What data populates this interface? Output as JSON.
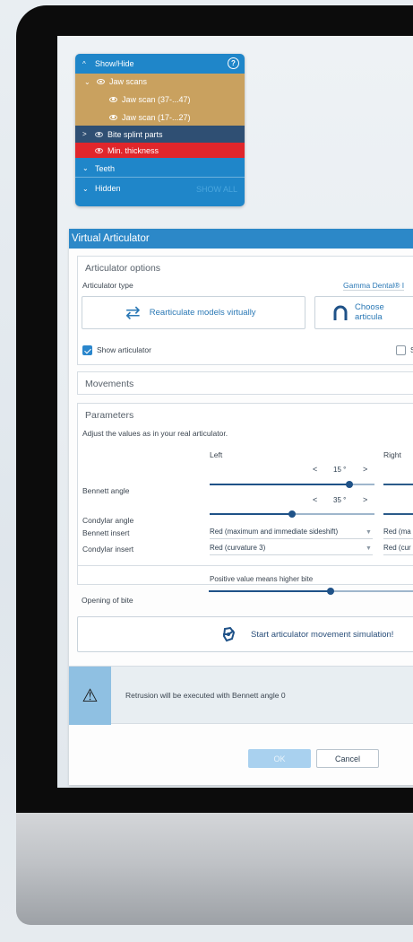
{
  "show_hide_panel": {
    "header_label": "Show/Hide",
    "help_glyph": "?",
    "jaw_scans_label": "Jaw scans",
    "jaw_scan_1": "Jaw scan (37-...47)",
    "jaw_scan_2": "Jaw scan (17-...27)",
    "bite_splint_label": "Bite splint parts",
    "min_thickness_label": "Min. thickness",
    "teeth_label": "Teeth",
    "hidden_label": "Hidden",
    "show_all_label": "SHOW ALL",
    "colors": {
      "panel": "#1f86c9",
      "tan": "#c9a15f",
      "navy": "#2f4f73",
      "red": "#e0262b"
    }
  },
  "dialog": {
    "title": "Virtual Articulator",
    "articulator_options": {
      "group_title": "Articulator options",
      "type_label": "Articulator type",
      "type_value": "Gamma Dental® I",
      "rearticulate_button": "Rearticulate models virtually",
      "choose_button_line1": "Choose",
      "choose_button_line2": "articula",
      "show_articulator_label": "Show articulator",
      "show_articulator_checked": true,
      "second_checkbox_label": "S"
    },
    "movements": {
      "group_title": "Movements"
    },
    "parameters": {
      "group_title": "Parameters",
      "hint": "Adjust the values as in your real articulator.",
      "left_header": "Left",
      "right_header": "Right",
      "bennett_angle": {
        "label": "Bennett angle",
        "left_value": "15 °",
        "slider_fraction": 0.85
      },
      "condylar_angle": {
        "label": "Condylar angle",
        "left_value": "35 °",
        "slider_fraction": 0.5
      },
      "bennett_insert": {
        "label": "Bennett insert",
        "left_value": "Red (maximum and immediate sideshift)",
        "right_value": "Red (ma"
      },
      "condylar_insert": {
        "label": "Condylar insert",
        "left_value": "Red (curvature 3)",
        "right_value": "Red (cur"
      },
      "opening_of_bite": {
        "label": "Opening of bite",
        "hint": "Positive value means higher bite",
        "slider_fraction": 0.58
      }
    },
    "simulation_button": "Start articulator movement simulation!",
    "warning_text": "Retrusion will be executed with Bennett angle 0",
    "ok_button": "OK",
    "cancel_button": "Cancel",
    "arrows": {
      "left": "<",
      "right": ">"
    }
  }
}
